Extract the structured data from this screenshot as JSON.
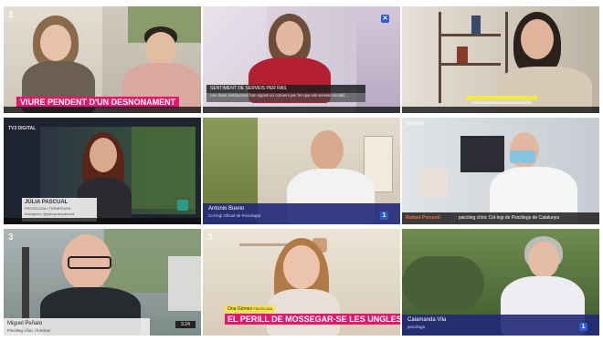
{
  "tiles": [
    {
      "channel_mark": "3",
      "banner": "VIURE PENDENT D'UN DESNONAMENT"
    },
    {
      "banner": "SENTIMENT DE SERVEIS PER RAS",
      "subtitle": "Les dues institucions han signat un conveni per fer que els serveis socials..."
    },
    {
      "caption": "",
      "caption_sub": ""
    },
    {
      "channel_mark": "TV3 DIGITAL",
      "name": "JÚLIA PASCUAL",
      "role": "PSICÒLOGA I TERAPEUTA",
      "handle": "Instagram: @psicojuliapascual"
    },
    {
      "name": "Antonio Bueno",
      "role": "Col·legi Oficial de Psicologia",
      "chan_badge": "1"
    },
    {
      "channel_mark": "betevé",
      "name": "Rafael Ponsetí",
      "role": "psicòleg clínic Col·legi de Psicòlegs de Catalunya"
    },
    {
      "channel_mark": "3",
      "name": "Miguel Peñalo",
      "role": "Psicòleg clínic i forense",
      "corner_mark": "3.24"
    },
    {
      "channel_mark": "3",
      "name": "Ona Gómez",
      "role": "PSICÒLOGA",
      "banner": "EL PERILL DE MOSSEGAR-SE LES UNGLES"
    },
    {
      "name": "Calamanda Vila",
      "role": "psicòloga",
      "chan_badge": "1"
    }
  ]
}
